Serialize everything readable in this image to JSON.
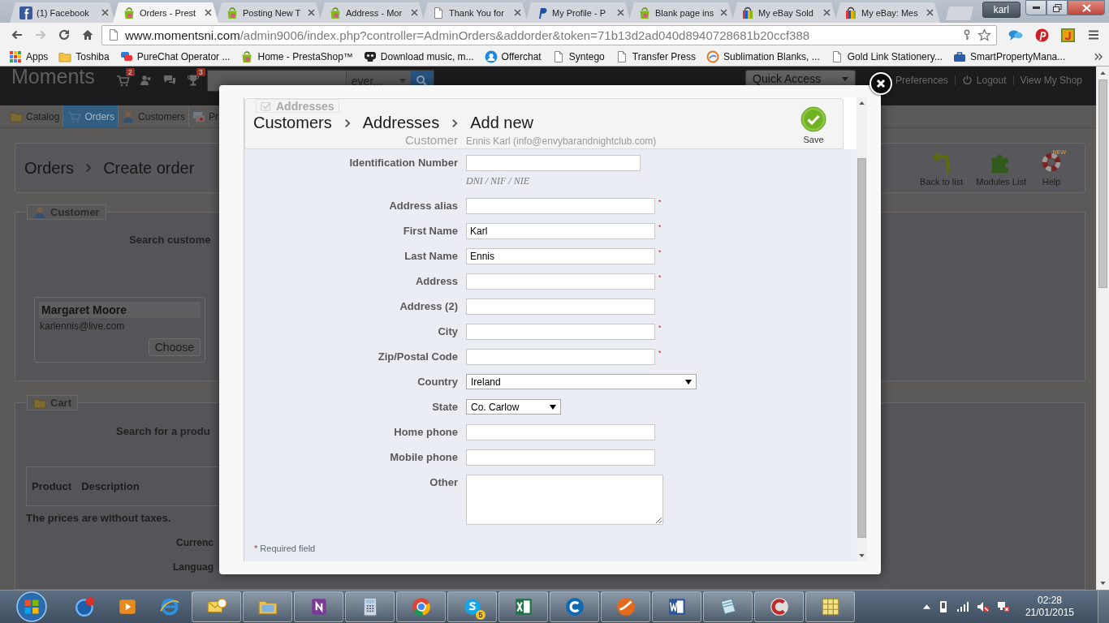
{
  "browser": {
    "tabs": [
      {
        "title": "(1) Facebook",
        "selected": false
      },
      {
        "title": "Orders - Prest",
        "selected": true
      },
      {
        "title": "Posting New T",
        "selected": false
      },
      {
        "title": "Address - Mor",
        "selected": false
      },
      {
        "title": "Thank You for",
        "selected": false
      },
      {
        "title": "My Profile - P",
        "selected": false
      },
      {
        "title": "Blank page ins",
        "selected": false
      },
      {
        "title": "My eBay Sold",
        "selected": false
      },
      {
        "title": "My eBay: Mes",
        "selected": false
      }
    ],
    "profile": "karl",
    "forward_disabled": true,
    "url": {
      "host": "www.momentsni.com",
      "path": "/admin9006/index.php?controller=AdminOrders&addorder&token=71b13d2ad040d8940728681b20ccf388"
    },
    "bookmarks": [
      "Apps",
      "Toshiba",
      "PureChat Operator ...",
      "Home - PrestaShop™",
      "Download music, m...",
      "Offerchat",
      "Syntego",
      "Transfer Press",
      "Sublimation Blanks, ...",
      "Gold Link Stationery...",
      "SmartPropertyMana..."
    ]
  },
  "admin": {
    "logo": "Moments",
    "header_badges": [
      "2",
      "3"
    ],
    "search_scope": "ever...",
    "quick_access": "Quick Access",
    "links": [
      "Preferences",
      "Logout",
      "View My Shop"
    ],
    "nav_tabs": [
      {
        "label": "Catalog",
        "selected": false
      },
      {
        "label": "Orders",
        "selected": true
      },
      {
        "label": "Customers",
        "selected": false
      },
      {
        "label": "Pr",
        "selected": false
      }
    ],
    "breadcrumb": [
      "Orders",
      "Create order"
    ],
    "toolbar": [
      {
        "label": "Back to list"
      },
      {
        "label": "Modules List"
      },
      {
        "label": "Help",
        "badge": "NEW"
      }
    ],
    "customer_section": {
      "legend": "Customer",
      "search_label": "Search custome",
      "card": {
        "name": "Margaret Moore",
        "email": "karlennis@live.com",
        "button": "Choose"
      }
    },
    "cart_section": {
      "legend": "Cart",
      "search_label": "Search for a produ",
      "columns": [
        "Product",
        "Description"
      ],
      "note": "The prices are without taxes.",
      "labels": [
        "Currenc",
        "Languag"
      ]
    }
  },
  "modal": {
    "ghost_title": "Addresses",
    "breadcrumb": [
      "Customers",
      "Addresses",
      "Add new"
    ],
    "customer": {
      "label": "Customer",
      "value": "Ennis Karl (info@envybarandnightclub.com)"
    },
    "save": "Save",
    "required_mark": "*",
    "fields": [
      {
        "label": "Identification Number",
        "kind": "text",
        "required": false,
        "hint": "DNI / NIF / NIE"
      },
      {
        "label": "Address alias",
        "kind": "text",
        "required": true
      },
      {
        "label": "First Name",
        "kind": "text",
        "value": "Karl",
        "required": true
      },
      {
        "label": "Last Name",
        "kind": "text",
        "value": "Ennis",
        "required": true
      },
      {
        "label": "Address",
        "kind": "text",
        "required": true
      },
      {
        "label": "Address (2)",
        "kind": "text",
        "required": false
      },
      {
        "label": "City",
        "kind": "text",
        "required": true
      },
      {
        "label": "Zip/Postal Code",
        "kind": "text",
        "required": true
      },
      {
        "label": "Country",
        "kind": "select",
        "value": "Ireland",
        "required": false
      },
      {
        "label": "State",
        "kind": "select",
        "value": "Co. Carlow",
        "required": false
      },
      {
        "label": "Home phone",
        "kind": "text",
        "required": false
      },
      {
        "label": "Mobile phone",
        "kind": "text",
        "required": false
      },
      {
        "label": "Other",
        "kind": "textarea",
        "required": false
      }
    ],
    "footnote": "Required field"
  },
  "taskbar": {
    "apps": [
      {
        "open": false
      },
      {
        "open": false
      },
      {
        "open": false
      },
      {
        "open": true
      },
      {
        "open": true
      },
      {
        "open": true
      },
      {
        "open": true
      },
      {
        "open": true
      },
      {
        "open": true,
        "badge": "5"
      },
      {
        "open": true
      },
      {
        "open": true
      },
      {
        "open": true
      },
      {
        "open": true
      },
      {
        "open": true
      },
      {
        "open": true
      },
      {
        "open": true
      }
    ],
    "time": "02:28",
    "date": "21/01/2015"
  }
}
